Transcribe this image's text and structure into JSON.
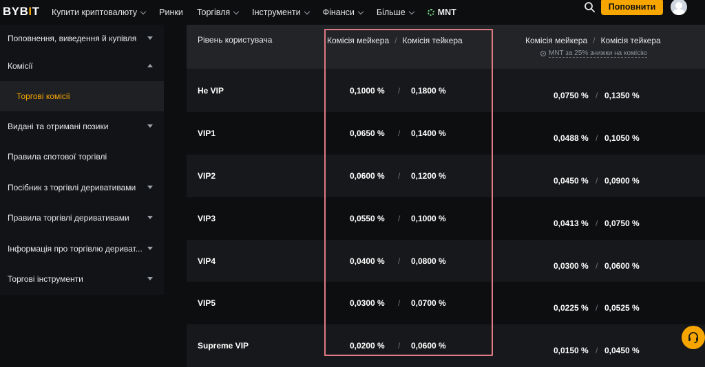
{
  "header": {
    "logo_text_pre": "BYB",
    "logo_text_bar": "I",
    "logo_text_post": "T",
    "nav": [
      {
        "label": "Купити криптовалюту",
        "dropdown": true
      },
      {
        "label": "Ринки",
        "dropdown": false
      },
      {
        "label": "Торгівля",
        "dropdown": true
      },
      {
        "label": "Інструменти",
        "dropdown": true
      },
      {
        "label": "Фінанси",
        "dropdown": true
      },
      {
        "label": "Більше",
        "dropdown": true
      }
    ],
    "mnt_label": "MNT",
    "topup_label": "Поповнити",
    "accent_color": "#f7a600"
  },
  "sidebar": {
    "items": [
      {
        "label": "Поповнення, виведення й купівля",
        "arrow": "down"
      },
      {
        "label": "Комісії",
        "arrow": "up"
      },
      {
        "label": "Торгові комісії",
        "arrow": "none",
        "active": true
      },
      {
        "label": "Видані та отримані позики",
        "arrow": "down"
      },
      {
        "label": "Правила спотової торгівлі",
        "arrow": "none"
      },
      {
        "label": "Посібник з торгівлі деривативами",
        "arrow": "down"
      },
      {
        "label": "Правила торгівлі деривативами",
        "arrow": "down"
      },
      {
        "label": "Інформація про торгівлю дериват...",
        "arrow": "down"
      },
      {
        "label": "Торгові інструменти",
        "arrow": "down"
      }
    ]
  },
  "table": {
    "col_level": "Рівень користувача",
    "col_maker": "Комісія мейкера",
    "col_taker": "Комісія тейкера",
    "col_maker_mnt": "Комісія мейкера",
    "col_taker_mnt": "Комісія тейкера",
    "separator": "/",
    "mnt_note": "MNT за 25% знижки на комісію",
    "rows": [
      {
        "level": "Не VIP",
        "maker": "0,1000 %",
        "taker": "0,1800 %",
        "maker_mnt": "0,0750 %",
        "taker_mnt": "0,1350 %"
      },
      {
        "level": "VIP1",
        "maker": "0,0650 %",
        "taker": "0,1400 %",
        "maker_mnt": "0,0488 %",
        "taker_mnt": "0,1050 %"
      },
      {
        "level": "VIP2",
        "maker": "0,0600 %",
        "taker": "0,1200 %",
        "maker_mnt": "0,0450 %",
        "taker_mnt": "0,0900 %"
      },
      {
        "level": "VIP3",
        "maker": "0,0550 %",
        "taker": "0,1000 %",
        "maker_mnt": "0,0413 %",
        "taker_mnt": "0,0750 %"
      },
      {
        "level": "VIP4",
        "maker": "0,0400 %",
        "taker": "0,0800 %",
        "maker_mnt": "0,0300 %",
        "taker_mnt": "0,0600 %"
      },
      {
        "level": "VIP5",
        "maker": "0,0300 %",
        "taker": "0,0700 %",
        "maker_mnt": "0,0225 %",
        "taker_mnt": "0,0525 %"
      },
      {
        "level": "Supreme VIP",
        "maker": "0,0200 %",
        "taker": "0,0600 %",
        "maker_mnt": "0,0150 %",
        "taker_mnt": "0,0450 %"
      }
    ]
  },
  "icons": {
    "search": "search-icon",
    "support": "headset-icon",
    "avatar": "avatar-icon",
    "highlight_color": "#e07a84"
  }
}
